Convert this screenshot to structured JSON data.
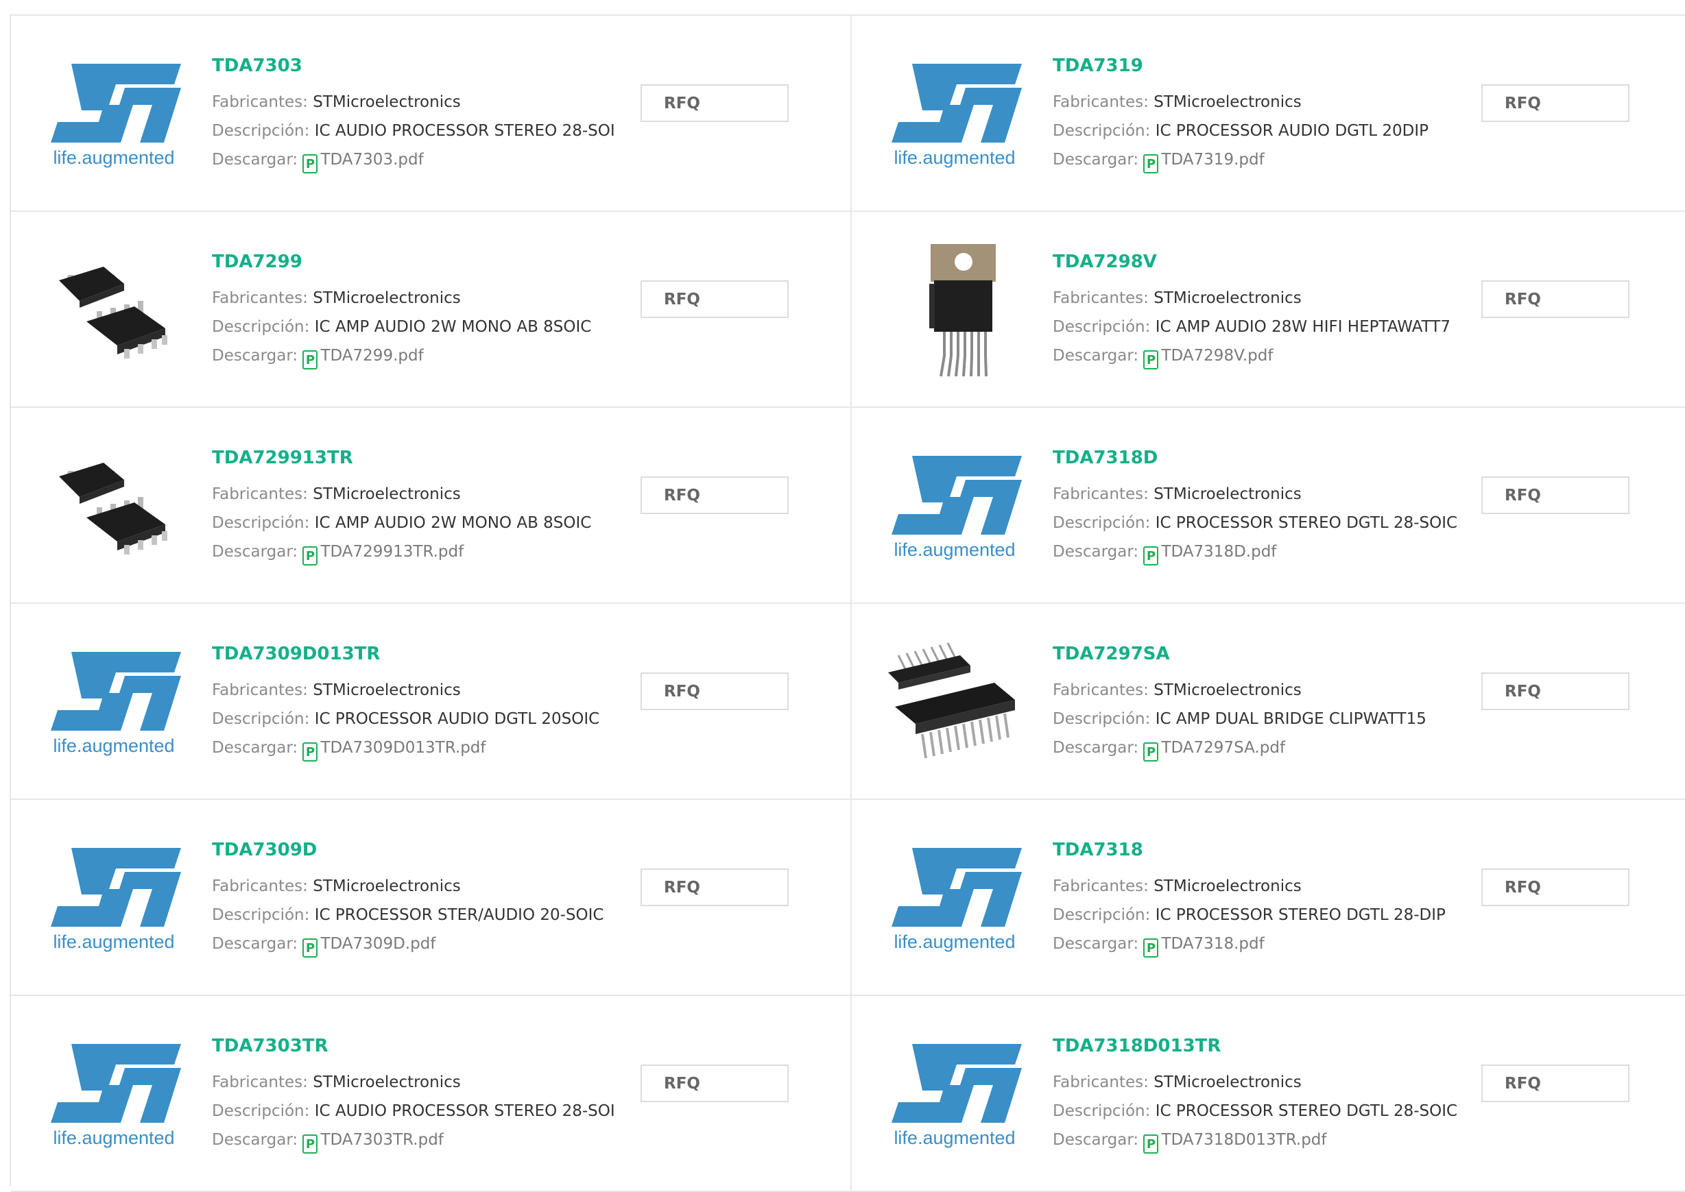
{
  "labels": {
    "manufacturer": "Fabricantes:",
    "description": "Descripción:",
    "download": "Descargar:",
    "rfq": "RFQ",
    "pdf_glyph": "P"
  },
  "logo_text": {
    "st": "ST",
    "tagline": "life.augmented"
  },
  "colors": {
    "title": "#14b089",
    "logo_blue": "#3a8fc7",
    "pdf_green": "#1fae55"
  },
  "products": [
    {
      "part": "TDA7303",
      "manufacturer": "STMicroelectronics",
      "description": "IC AUDIO PROCESSOR STEREO 28-SOI",
      "pdf": "TDA7303.pdf",
      "image": "st-logo"
    },
    {
      "part": "TDA7319",
      "manufacturer": "STMicroelectronics",
      "description": "IC PROCESSOR AUDIO DGTL 20DIP",
      "pdf": "TDA7319.pdf",
      "image": "st-logo"
    },
    {
      "part": "TDA7299",
      "manufacturer": "STMicroelectronics",
      "description": "IC AMP AUDIO 2W MONO AB 8SOIC",
      "pdf": "TDA7299.pdf",
      "image": "soic-chip"
    },
    {
      "part": "TDA7298V",
      "manufacturer": "STMicroelectronics",
      "description": "IC AMP AUDIO 28W HIFI HEPTAWATT7",
      "pdf": "TDA7298V.pdf",
      "image": "heptawatt-chip"
    },
    {
      "part": "TDA729913TR",
      "manufacturer": "STMicroelectronics",
      "description": "IC AMP AUDIO 2W MONO AB 8SOIC",
      "pdf": "TDA729913TR.pdf",
      "image": "soic-chip"
    },
    {
      "part": "TDA7318D",
      "manufacturer": "STMicroelectronics",
      "description": "IC PROCESSOR STEREO DGTL 28-SOIC",
      "pdf": "TDA7318D.pdf",
      "image": "st-logo"
    },
    {
      "part": "TDA7309D013TR",
      "manufacturer": "STMicroelectronics",
      "description": "IC PROCESSOR AUDIO DGTL 20SOIC",
      "pdf": "TDA7309D013TR.pdf",
      "image": "st-logo"
    },
    {
      "part": "TDA7297SA",
      "manufacturer": "STMicroelectronics",
      "description": "IC AMP DUAL BRIDGE CLIPWATT15",
      "pdf": "TDA7297SA.pdf",
      "image": "clipwatt-chip"
    },
    {
      "part": "TDA7309D",
      "manufacturer": "STMicroelectronics",
      "description": "IC PROCESSOR STER/AUDIO 20-SOIC",
      "pdf": "TDA7309D.pdf",
      "image": "st-logo"
    },
    {
      "part": "TDA7318",
      "manufacturer": "STMicroelectronics",
      "description": "IC PROCESSOR STEREO DGTL 28-DIP",
      "pdf": "TDA7318.pdf",
      "image": "st-logo"
    },
    {
      "part": "TDA7303TR",
      "manufacturer": "STMicroelectronics",
      "description": "IC AUDIO PROCESSOR STEREO 28-SOI",
      "pdf": "TDA7303TR.pdf",
      "image": "st-logo"
    },
    {
      "part": "TDA7318D013TR",
      "manufacturer": "STMicroelectronics",
      "description": "IC PROCESSOR STEREO DGTL 28-SOIC",
      "pdf": "TDA7318D013TR.pdf",
      "image": "st-logo"
    }
  ]
}
